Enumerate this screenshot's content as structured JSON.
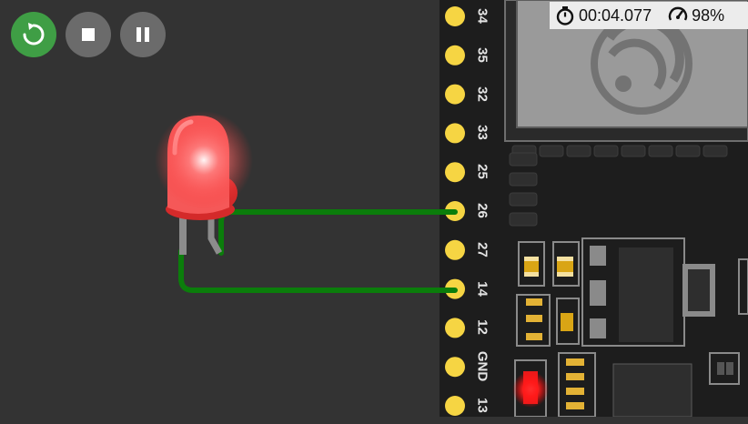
{
  "toolbar": {
    "restart_icon": "restart-icon",
    "stop_icon": "stop-icon",
    "pause_icon": "pause-icon",
    "restart_color": "#3f9e45",
    "stop_color": "#6b6b6b",
    "pause_color": "#6b6b6b"
  },
  "status": {
    "timer_icon": "stopwatch-icon",
    "elapsed": "00:04.077",
    "speed_icon": "speedometer-icon",
    "speed": "98%"
  },
  "board": {
    "pins": [
      "34",
      "35",
      "32",
      "33",
      "25",
      "26",
      "27",
      "14",
      "12",
      "GND",
      "13"
    ],
    "pin_color": "#f6d543",
    "board_color": "#1d1d1d",
    "wire_color": "#0b7d0b"
  },
  "led": {
    "color": "#ff3a3a",
    "state": "on"
  },
  "onboard_led": {
    "color": "#ff1a1a",
    "state": "on"
  }
}
